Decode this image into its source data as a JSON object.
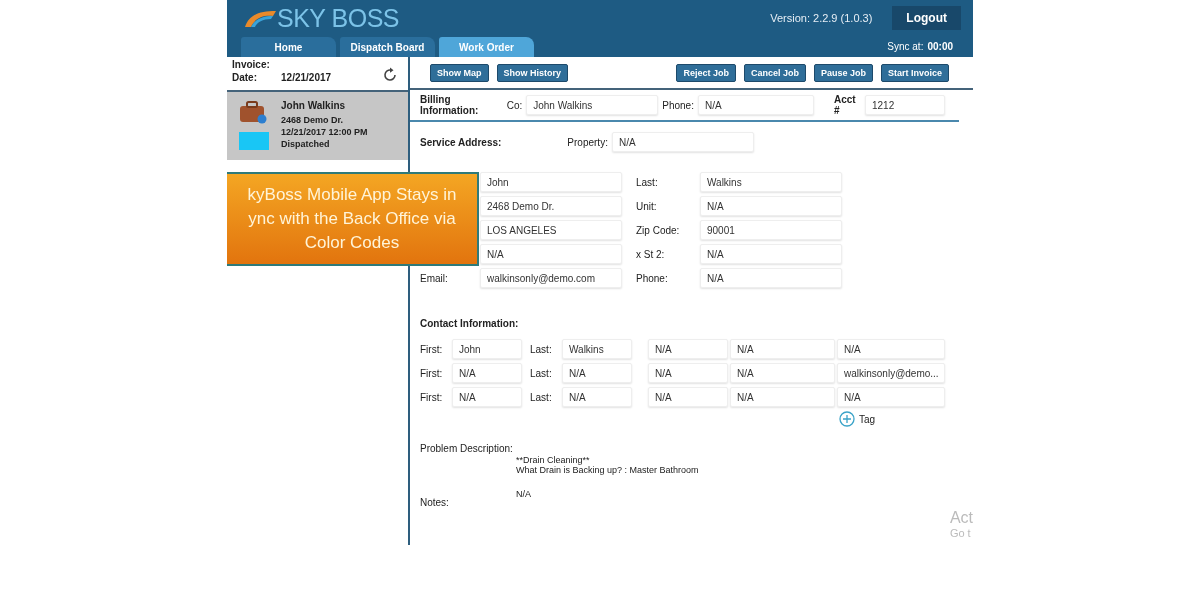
{
  "header": {
    "logo": "SKY BOSS",
    "version": "Version: 2.2.9 (1.0.3)",
    "logout": "Logout",
    "sync_label": "Sync at:",
    "sync_value": "00:00"
  },
  "tabs": [
    {
      "label": "Home",
      "selected": false
    },
    {
      "label": "Dispatch Board",
      "selected": false
    },
    {
      "label": "Work Order",
      "selected": true
    }
  ],
  "sidebar": {
    "invoice_label": "Invoice:",
    "date_label": "Date:",
    "date": "12/21/2017",
    "job": {
      "name": "John Walkins",
      "address": "2468 Demo Dr.",
      "datetime": "12/21/2017 12:00 PM",
      "status": "Dispatched",
      "color": "#19c6f5"
    }
  },
  "toolbar": {
    "left": [
      "Show Map",
      "Show History"
    ],
    "right": [
      "Reject Job",
      "Cancel Job",
      "Pause Job",
      "Start Invoice"
    ]
  },
  "billing": {
    "title": "Billing Information:",
    "co_label": "Co:",
    "co": "John Walkins",
    "phone_label": "Phone:",
    "phone": "N/A",
    "acct_label": "Acct #",
    "acct": "1212"
  },
  "service": {
    "title": "Service Address:",
    "property_label": "Property:",
    "property": "N/A",
    "rows": [
      {
        "left_value": "John",
        "right_label": "Last:",
        "right_value": "Walkins"
      },
      {
        "left_value": "2468 Demo Dr.",
        "right_label": "Unit:",
        "right_value": "N/A"
      },
      {
        "left_value": "LOS ANGELES",
        "right_label": "Zip Code:",
        "right_value": "90001"
      },
      {
        "left_value": "N/A",
        "right_label": "x St 2:",
        "right_value": "N/A"
      },
      {
        "left_label": "Email:",
        "left_value": "walkinsonly@demo.com",
        "right_label": "Phone:",
        "right_value": "N/A"
      }
    ]
  },
  "contact": {
    "title": "Contact Information:",
    "rows": [
      {
        "first_label": "First:",
        "first": "John",
        "last_label": "Last:",
        "last": "Walkins",
        "column_3": "N/A",
        "column_4": "N/A",
        "column_5": "N/A"
      },
      {
        "first_label": "First:",
        "first": "N/A",
        "last_label": "Last:",
        "last": "N/A",
        "column_3": "N/A",
        "column_4": "N/A",
        "column_5": "walkinsonly@demo..."
      },
      {
        "first_label": "First:",
        "first": "N/A",
        "last_label": "Last:",
        "last": "N/A",
        "column_3": "N/A",
        "column_4": "N/A",
        "column_5": "N/A"
      }
    ],
    "tag": "Tag"
  },
  "problem": {
    "label": "Problem Description:",
    "lines": [
      "**Drain Cleaning**",
      "What Drain is Backing up? : Master Bathroom"
    ]
  },
  "notes": {
    "label": "Notes:",
    "value": "N/A"
  },
  "callout": {
    "lines": [
      "kyBoss Mobile App Stays in",
      "ync with the Back Office via",
      "Color Codes"
    ]
  },
  "activation_notice": [
    "Act",
    "Go t"
  ]
}
